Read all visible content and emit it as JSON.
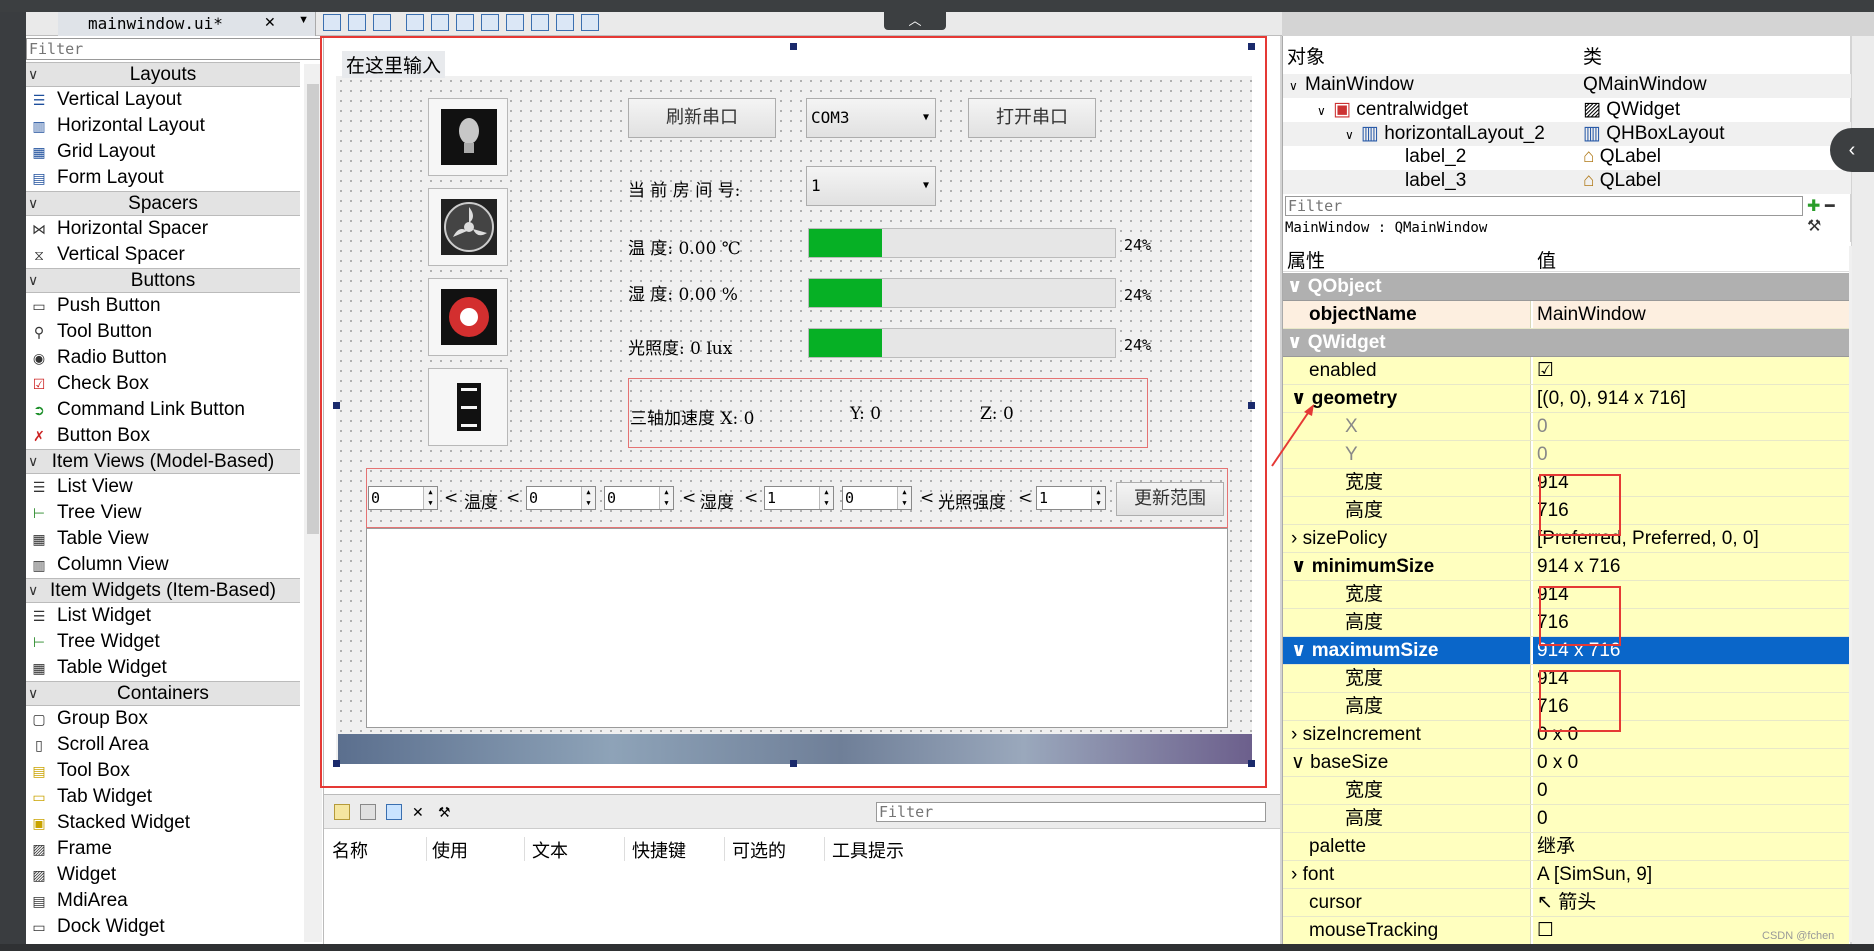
{
  "designer": {
    "file_tab": "mainwindow.ui*"
  },
  "widget_box": {
    "filter_placeholder": "Filter",
    "categories": [
      {
        "label": "Layouts",
        "items": [
          {
            "label": "Vertical Layout",
            "icon": "vertical-layout-icon"
          },
          {
            "label": "Horizontal Layout",
            "icon": "horizontal-layout-icon"
          },
          {
            "label": "Grid Layout",
            "icon": "grid-layout-icon"
          },
          {
            "label": "Form Layout",
            "icon": "form-layout-icon"
          }
        ]
      },
      {
        "label": "Spacers",
        "items": [
          {
            "label": "Horizontal Spacer",
            "icon": "horizontal-spacer-icon"
          },
          {
            "label": "Vertical Spacer",
            "icon": "vertical-spacer-icon"
          }
        ]
      },
      {
        "label": "Buttons",
        "items": [
          {
            "label": "Push Button",
            "icon": "push-button-icon"
          },
          {
            "label": "Tool Button",
            "icon": "tool-button-icon"
          },
          {
            "label": "Radio Button",
            "icon": "radio-button-icon"
          },
          {
            "label": "Check Box",
            "icon": "check-box-icon"
          },
          {
            "label": "Command Link Button",
            "icon": "command-link-icon"
          },
          {
            "label": "Button Box",
            "icon": "button-box-icon"
          }
        ]
      },
      {
        "label": "Item Views (Model-Based)",
        "items": [
          {
            "label": "List View",
            "icon": "list-view-icon"
          },
          {
            "label": "Tree View",
            "icon": "tree-view-icon"
          },
          {
            "label": "Table View",
            "icon": "table-view-icon"
          },
          {
            "label": "Column View",
            "icon": "column-view-icon"
          }
        ]
      },
      {
        "label": "Item Widgets (Item-Based)",
        "items": [
          {
            "label": "List Widget",
            "icon": "list-widget-icon"
          },
          {
            "label": "Tree Widget",
            "icon": "tree-widget-icon"
          },
          {
            "label": "Table Widget",
            "icon": "table-widget-icon"
          }
        ]
      },
      {
        "label": "Containers",
        "items": [
          {
            "label": "Group Box",
            "icon": "group-box-icon"
          },
          {
            "label": "Scroll Area",
            "icon": "scroll-area-icon"
          },
          {
            "label": "Tool Box",
            "icon": "tool-box-icon"
          },
          {
            "label": "Tab Widget",
            "icon": "tab-widget-icon"
          },
          {
            "label": "Stacked Widget",
            "icon": "stacked-widget-icon"
          },
          {
            "label": "Frame",
            "icon": "frame-icon"
          },
          {
            "label": "Widget",
            "icon": "widget-icon"
          },
          {
            "label": "MdiArea",
            "icon": "mdi-area-icon"
          },
          {
            "label": "Dock Widget",
            "icon": "dock-widget-icon"
          }
        ]
      }
    ]
  },
  "form": {
    "menu_placeholder": "在这里输入",
    "refresh_button": "刷新串口",
    "port_combo": "COM3",
    "open_button": "打开串口",
    "room_label": "当 前 房 间 号:",
    "room_combo": "1",
    "temp_label": "温    度: 0.00 ℃",
    "humid_label": "湿    度: 0.00 %",
    "light_label": "光照度: 0 lux",
    "progress": [
      {
        "value": 24,
        "text": "24%"
      },
      {
        "value": 24,
        "text": "24%"
      },
      {
        "value": 24,
        "text": "24%"
      }
    ],
    "accel_label": "三轴加速度 X: 0",
    "accel_y": "Y: 0",
    "accel_z": "Z: 0",
    "range_row": {
      "spin1": "0",
      "sep1": "<",
      "temp": "温度",
      "sep2": "<",
      "spin2": "0",
      "spin3": "0",
      "sep3": "<",
      "humid": "湿度",
      "sep4": "<",
      "spin4": "1",
      "spin5": "0",
      "sep5": "<",
      "light": "光照强度",
      "sep6": "<",
      "spin6": "1",
      "update_button": "更新范围"
    },
    "icons": [
      "bulb-icon",
      "fan-icon",
      "alarm-icon",
      "seven-segment-icon"
    ]
  },
  "action_editor": {
    "filter_placeholder": "Filter",
    "columns": [
      "名称",
      "使用",
      "文本",
      "快捷键",
      "可选的",
      "工具提示"
    ]
  },
  "object_inspector": {
    "col_object": "对象",
    "col_class": "类",
    "rows": [
      {
        "name": "MainWindow",
        "class": "QMainWindow"
      },
      {
        "name": "centralwidget",
        "class": "QWidget"
      },
      {
        "name": "horizontalLayout_2",
        "class": "QHBoxLayout"
      },
      {
        "name": "label_2",
        "class": "QLabel"
      },
      {
        "name": "label_3",
        "class": "QLabel"
      }
    ]
  },
  "property_editor": {
    "filter_placeholder": "Filter",
    "context": "MainWindow : QMainWindow",
    "col_property": "属性",
    "col_value": "值",
    "rows": [
      {
        "name": "QObject",
        "value": "",
        "kind": "group"
      },
      {
        "name": "objectName",
        "value": "MainWindow",
        "kind": "bold"
      },
      {
        "name": "QWidget",
        "value": "",
        "kind": "group"
      },
      {
        "name": "enabled",
        "value": "☑",
        "kind": "normal"
      },
      {
        "name": "geometry",
        "value": "[(0, 0), 914 x 716]",
        "kind": "bold-exp"
      },
      {
        "name": "X",
        "value": "0",
        "kind": "dim"
      },
      {
        "name": "Y",
        "value": "0",
        "kind": "dim"
      },
      {
        "name": "宽度",
        "value": "914",
        "kind": "child"
      },
      {
        "name": "高度",
        "value": "716",
        "kind": "child"
      },
      {
        "name": "sizePolicy",
        "value": "[Preferred, Preferred, 0, 0]",
        "kind": "coll"
      },
      {
        "name": "minimumSize",
        "value": "914 x 716",
        "kind": "bold-exp"
      },
      {
        "name": "宽度",
        "value": "914",
        "kind": "child"
      },
      {
        "name": "高度",
        "value": "716",
        "kind": "child"
      },
      {
        "name": "maximumSize",
        "value": "914 x 716",
        "kind": "selected"
      },
      {
        "name": "宽度",
        "value": "914",
        "kind": "child"
      },
      {
        "name": "高度",
        "value": "716",
        "kind": "child"
      },
      {
        "name": "sizeIncrement",
        "value": "0 x 0",
        "kind": "coll"
      },
      {
        "name": "baseSize",
        "value": "0 x 0",
        "kind": "exp"
      },
      {
        "name": "宽度",
        "value": "0",
        "kind": "child"
      },
      {
        "name": "高度",
        "value": "0",
        "kind": "child"
      },
      {
        "name": "palette",
        "value": "继承",
        "kind": "normal"
      },
      {
        "name": "font",
        "value": "A  [SimSun, 9]",
        "kind": "coll"
      },
      {
        "name": "cursor",
        "value": "↖  箭头",
        "kind": "normal"
      },
      {
        "name": "mouseTracking",
        "value": "☐",
        "kind": "normal"
      }
    ]
  },
  "watermark": "CSDN @fchen"
}
